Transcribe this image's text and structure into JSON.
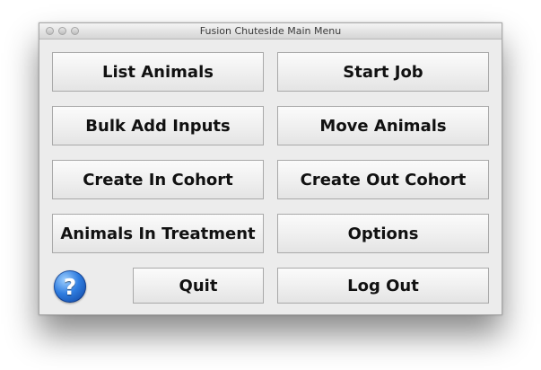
{
  "window": {
    "title": "Fusion Chuteside Main Menu"
  },
  "buttons": {
    "list_animals": "List Animals",
    "start_job": "Start Job",
    "bulk_add_inputs": "Bulk Add Inputs",
    "move_animals": "Move Animals",
    "create_in_cohort": "Create In Cohort",
    "create_out_cohort": "Create Out Cohort",
    "animals_in_treatment": "Animals In Treatment",
    "options": "Options",
    "quit": "Quit",
    "log_out": "Log Out"
  },
  "help": {
    "icon": "question-mark-icon",
    "glyph": "?"
  },
  "colors": {
    "window_bg": "#ececec",
    "button_border": "#a9a9a9",
    "help_blue": "#2f7de0"
  }
}
